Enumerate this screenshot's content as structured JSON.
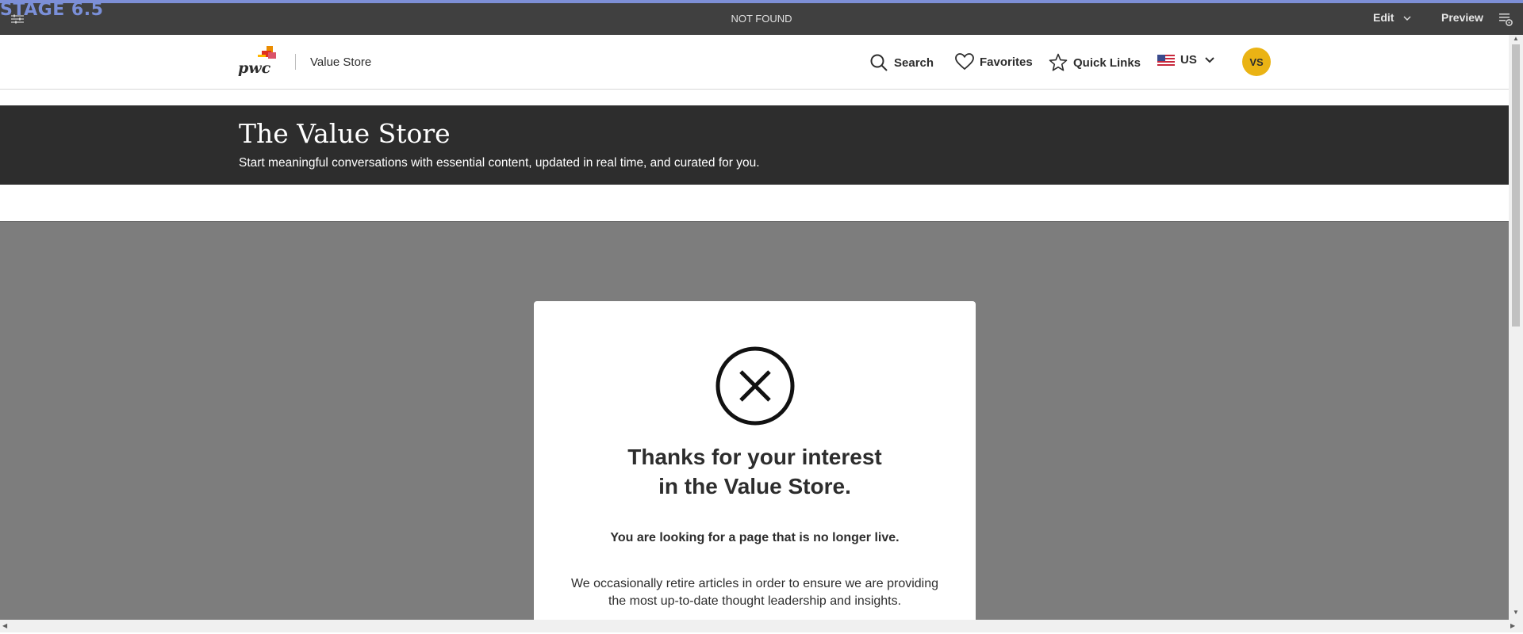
{
  "author_bar": {
    "stage_label": "STAGE 6.5",
    "page_status": "NOT FOUND",
    "edit_label": "Edit",
    "preview_label": "Preview"
  },
  "header": {
    "logo_text": "pwc",
    "brand_name": "Value Store",
    "nav": {
      "search_label": "Search",
      "favorites_label": "Favorites",
      "quick_links_label": "Quick Links",
      "locale_label": "US"
    },
    "avatar_initials": "VS"
  },
  "hero": {
    "title": "The Value Store",
    "subtitle": "Start meaningful conversations with essential content, updated in real time, and curated for you."
  },
  "modal": {
    "title_line1": "Thanks for your interest",
    "title_line2": "in the Value Store.",
    "lead": "You are looking for a page that is no longer live.",
    "body_line1": "We occasionally retire articles in order to ensure we are providing",
    "body_line2": "the most up-to-date thought leadership and insights."
  },
  "colors": {
    "author_bar": "#404040",
    "accent": "#7d8fd6",
    "hero": "#2d2d2d",
    "overlay": "#7d7d7d",
    "avatar": "#eab314",
    "logo_orange": "#e0301e"
  },
  "icons": [
    "sliders-icon",
    "chevron-down-icon",
    "panel-settings-icon",
    "search-icon",
    "heart-icon",
    "star-icon",
    "us-flag-icon",
    "close-circle-icon"
  ]
}
